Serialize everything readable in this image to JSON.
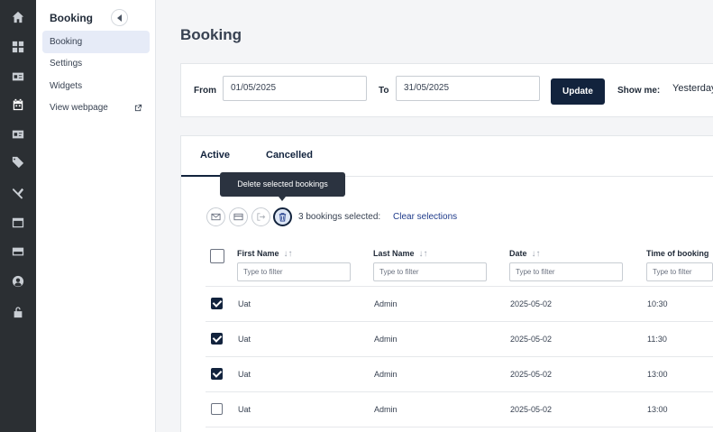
{
  "rail": {
    "icons": [
      "home-icon",
      "dashboard-icon",
      "contact-card-icon",
      "calendar-icon",
      "id-card-icon",
      "tags-icon",
      "tools-icon",
      "window-icon",
      "credit-card-icon",
      "user-circle-icon",
      "unlock-icon"
    ],
    "active": "calendar-icon"
  },
  "sidebar": {
    "title": "Booking",
    "items": [
      {
        "label": "Booking",
        "active": true
      },
      {
        "label": "Settings"
      },
      {
        "label": "Widgets"
      },
      {
        "label": "View webpage",
        "external": true
      }
    ]
  },
  "page": {
    "title": "Booking"
  },
  "filters": {
    "from_label": "From",
    "from_value": "01/05/2025",
    "to_label": "To",
    "to_value": "31/05/2025",
    "update_label": "Update",
    "show_me_label": "Show me:",
    "show_me_value": "Yesterday"
  },
  "tabs": [
    {
      "label": "Active",
      "active": true
    },
    {
      "label": "Cancelled"
    }
  ],
  "actions": {
    "tooltip": "Delete selected bookings",
    "buttons": [
      "mail-icon",
      "payment-icon",
      "export-icon",
      "trash-icon"
    ],
    "selected_text": "3 bookings selected:",
    "clear_label": "Clear selections"
  },
  "table": {
    "columns": [
      {
        "label": "First Name",
        "placeholder": "Type to filter"
      },
      {
        "label": "Last Name",
        "placeholder": "Type to filter"
      },
      {
        "label": "Date",
        "placeholder": "Type to filter"
      },
      {
        "label": "Time of booking",
        "placeholder": "Type to filter"
      }
    ],
    "rows": [
      {
        "checked": true,
        "cells": [
          "Uat",
          "Admin",
          "2025-05-02",
          "10:30"
        ]
      },
      {
        "checked": true,
        "cells": [
          "Uat",
          "Admin",
          "2025-05-02",
          "11:30"
        ]
      },
      {
        "checked": true,
        "cells": [
          "Uat",
          "Admin",
          "2025-05-02",
          "13:00"
        ]
      },
      {
        "checked": false,
        "cells": [
          "Uat",
          "Admin",
          "2025-05-02",
          "13:00"
        ]
      }
    ]
  },
  "colors": {
    "rail_bg": "#2b2f33",
    "accent": "#12233d",
    "active_item_bg": "#e6ebf7",
    "link": "#1e3a8a"
  }
}
